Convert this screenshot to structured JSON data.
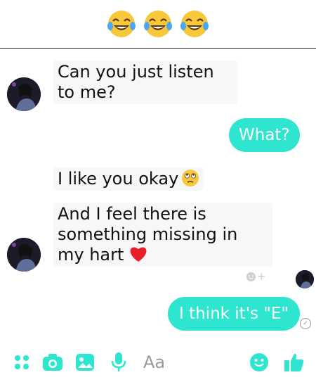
{
  "header": {
    "emojis": [
      "tears-of-joy-emoji",
      "tears-of-joy-emoji",
      "tears-of-joy-emoji"
    ]
  },
  "messages": {
    "incoming_1": "Can you just listen to me?",
    "outgoing_1": "What?",
    "incoming_2": "I like you okay",
    "incoming_3": "And I feel there is something missing in my hart",
    "outgoing_2": "I think it's \"E\""
  },
  "reaction": {
    "label": "+"
  },
  "composer": {
    "placeholder": "Aa",
    "icons": [
      "more-dots-icon",
      "camera-icon",
      "image-icon",
      "microphone-icon",
      "emoji-icon",
      "thumbs-up-icon"
    ]
  },
  "colors": {
    "accent": "#2ee6cf",
    "outgoing_bubble": "#2ee6cf",
    "incoming_bg": "#f7f7f7"
  }
}
